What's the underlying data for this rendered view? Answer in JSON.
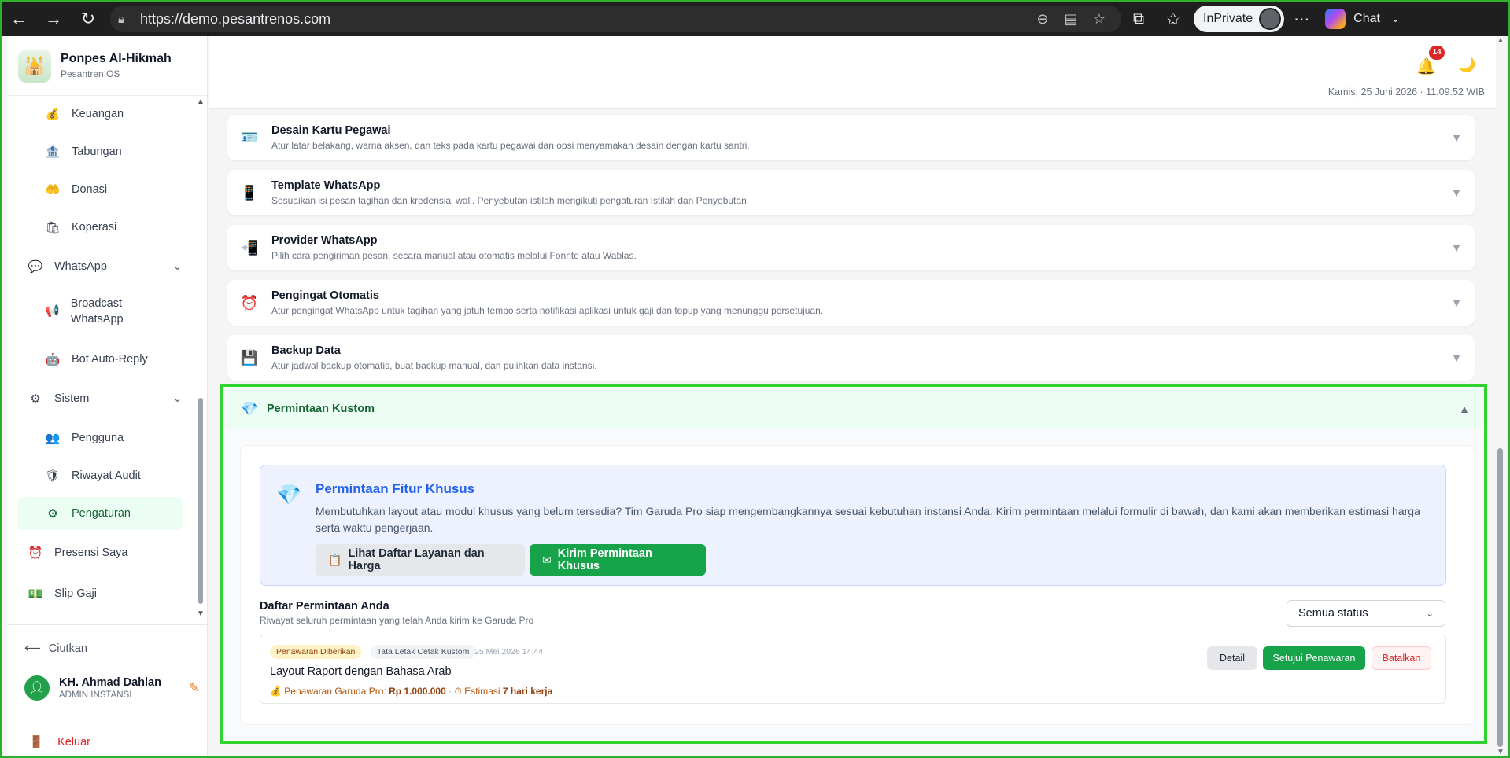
{
  "browser": {
    "url": "https://demo.pesantrenos.com",
    "inprivate_label": "InPrivate",
    "chat_label": "Chat"
  },
  "sidebar": {
    "app_name": "Ponpes Al-Hikmah",
    "app_sub": "Pesantren OS",
    "items": [
      {
        "label": "Keuangan",
        "icon": "💰"
      },
      {
        "label": "Tabungan",
        "icon": "🏦"
      },
      {
        "label": "Donasi",
        "icon": "🤲"
      },
      {
        "label": "Koperasi",
        "icon": "🛍"
      },
      {
        "label": "WhatsApp",
        "icon": "💬"
      },
      {
        "label": "Broadcast WhatsApp",
        "icon": "📢"
      },
      {
        "label": "Bot Auto-Reply",
        "icon": "🤖"
      },
      {
        "label": "Sistem",
        "icon": "⚙"
      },
      {
        "label": "Pengguna",
        "icon": "👥"
      },
      {
        "label": "Riwayat Audit",
        "icon": "🛡"
      },
      {
        "label": "Pengaturan",
        "icon": "⚙"
      },
      {
        "label": "Presensi Saya",
        "icon": "⏰"
      },
      {
        "label": "Slip Gaji",
        "icon": "💵"
      }
    ],
    "collapse_label": "Ciutkan",
    "user_name": "KH. Ahmad Dahlan",
    "user_role": "ADMIN INSTANSI",
    "logout_label": "Keluar"
  },
  "topbar": {
    "notif_count": "14",
    "datetime": "Kamis, 25 Juni 2026 · 11.09.52 WIB"
  },
  "settings": [
    {
      "title": "Desain Kartu Pegawai",
      "desc": "Atur latar belakang, warna aksen, dan teks pada kartu pegawai dan opsi menyamakan desain dengan kartu santri.",
      "icon": "🪪"
    },
    {
      "title": "Template WhatsApp",
      "desc": "Sesuaikan isi pesan tagihan dan kredensial wali. Penyebutan istilah mengikuti pengaturan Istilah dan Penyebutan.",
      "icon": "📱"
    },
    {
      "title": "Provider WhatsApp",
      "desc": "Pilih cara pengiriman pesan, secara manual atau otomatis melalui Fonnte atau Wablas.",
      "icon": "📲"
    },
    {
      "title": "Pengingat Otomatis",
      "desc": "Atur pengingat WhatsApp untuk tagihan yang jatuh tempo serta notifikasi aplikasi untuk gaji dan topup yang menunggu persetujuan.",
      "icon": "⏰"
    },
    {
      "title": "Backup Data",
      "desc": "Atur jadwal backup otomatis, buat backup manual, dan pulihkan data instansi.",
      "icon": "💾"
    }
  ],
  "custom": {
    "title": "Permintaan Kustom",
    "promo_title": "Permintaan Fitur Khusus",
    "promo_text": "Membutuhkan layout atau modul khusus yang belum tersedia? Tim Garuda Pro siap mengembangkannya sesuai kebutuhan instansi Anda. Kirim permintaan melalui formulir di bawah, dan kami akan memberikan estimasi harga serta waktu pengerjaan.",
    "btn_list": "Lihat Daftar Layanan dan Harga",
    "btn_send": "Kirim Permintaan Khusus",
    "list_title": "Daftar Permintaan Anda",
    "list_sub": "Riwayat seluruh permintaan yang telah Anda kirim ke Garuda Pro",
    "filter_value": "Semua status",
    "request": {
      "status": "Penawaran Diberikan",
      "category": "Tata Letak Cetak Kustom",
      "date": "25 Mei 2026 14:44",
      "title": "Layout Raport dengan Bahasa Arab",
      "offer_label": "Penawaran Garuda Pro:",
      "offer_value": "Rp 1.000.000",
      "estimate_label": "Estimasi",
      "estimate_value": "7 hari kerja",
      "btn_detail": "Detail",
      "btn_accept": "Setujui Penawaran",
      "btn_cancel": "Batalkan"
    }
  }
}
